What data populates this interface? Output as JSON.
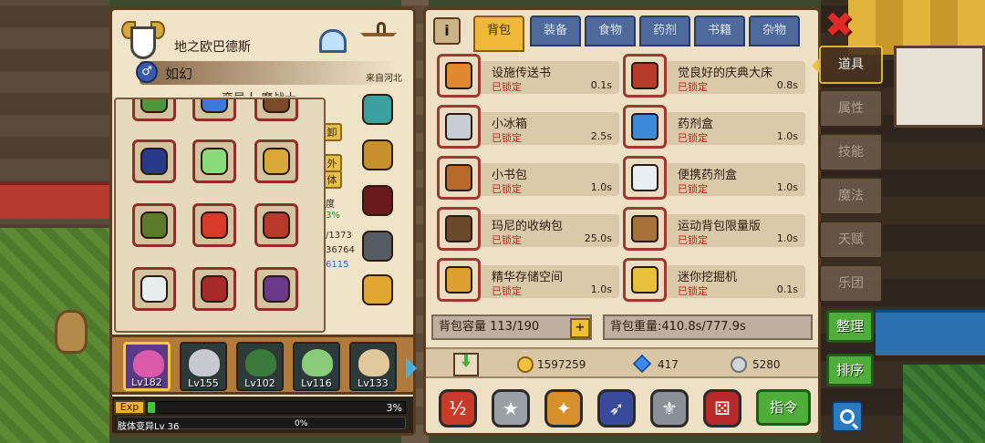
{
  "character": {
    "title": "地之欧巴德斯",
    "name": "如幻",
    "origin": "来自河北",
    "subtitle": "变异人 魔战士",
    "gender_icon": "male-symbol",
    "side_tags": [
      "卸",
      "外",
      "体"
    ],
    "stat_fragments": [
      "度",
      "3%",
      "/1373",
      "36764",
      "6115"
    ],
    "equipment_slots": [
      {
        "name": "green-bracelet",
        "color": "#4a9a3a"
      },
      {
        "name": "blue-amulet",
        "color": "#3a7ad8"
      },
      {
        "name": "dark-gauntlet",
        "color": "#7a4a2a"
      },
      {
        "name": "blue-gold-glove",
        "color": "#2a3a8a"
      },
      {
        "name": "green-mirror-ring",
        "color": "#8adc7a"
      },
      {
        "name": "gold-ring",
        "color": "#d8a83a"
      },
      {
        "name": "winged-boot",
        "color": "#5a7a2a"
      },
      {
        "name": "red-boot",
        "color": "#d83a2a"
      },
      {
        "name": "red-gauntlets",
        "color": "#b83a2a"
      },
      {
        "name": "white-sword-boot",
        "color": "#e8eef0"
      },
      {
        "name": "red-helmet",
        "color": "#a82a2a"
      },
      {
        "name": "purple-helmet",
        "color": "#6a3a8a"
      }
    ],
    "side_equipment": [
      {
        "name": "crystal-pendant",
        "color": "#3aa0a0"
      },
      {
        "name": "golden-armor",
        "color": "#c8902a"
      },
      {
        "name": "crimson-chest",
        "color": "#6a1a1a"
      },
      {
        "name": "iron-piece",
        "color": "#555c66"
      },
      {
        "name": "jeweled-ring",
        "color": "#e0a830"
      }
    ]
  },
  "party": [
    {
      "level": "Lv182",
      "color": "#d85aa8"
    },
    {
      "level": "Lv155",
      "color": "#c8c8d0"
    },
    {
      "level": "Lv102",
      "color": "#3a7a3a"
    },
    {
      "level": "Lv116",
      "color": "#8acc7a"
    },
    {
      "level": "Lv133",
      "color": "#e0c89a"
    }
  ],
  "experience": {
    "label": "Exp",
    "percent_text": "3%",
    "fill": 0.03,
    "sub_label": "肢体变异Lv 36",
    "sub_percent_text": "0%"
  },
  "inventory": {
    "tabs": [
      "背包",
      "装备",
      "食物",
      "药剂",
      "书籍",
      "杂物"
    ],
    "active_tab": 0,
    "items": [
      {
        "name": "设施传送书",
        "lock": "已锁定",
        "weight": "0.1s",
        "color": "#e08a30"
      },
      {
        "name": "觉良好的庆典大床",
        "lock": "已锁定",
        "weight": "0.8s",
        "color": "#b83a2a"
      },
      {
        "name": "小冰箱",
        "lock": "已锁定",
        "weight": "2.5s",
        "color": "#c8ccd4"
      },
      {
        "name": "药剂盒",
        "lock": "已锁定",
        "weight": "1.0s",
        "color": "#3a8ad8"
      },
      {
        "name": "小书包",
        "lock": "已锁定",
        "weight": "1.0s",
        "color": "#b86a2a"
      },
      {
        "name": "便携药剂盒",
        "lock": "已锁定",
        "weight": "1.0s",
        "color": "#e8eef4"
      },
      {
        "name": "玛尼的收纳包",
        "lock": "已锁定",
        "weight": "25.0s",
        "color": "#6a4a2a"
      },
      {
        "name": "运动背包限量版",
        "lock": "已锁定",
        "weight": "1.0s",
        "color": "#a8703a"
      },
      {
        "name": "精华存储空间",
        "lock": "已锁定",
        "weight": "1.0s",
        "color": "#e0a030"
      },
      {
        "name": "迷你挖掘机",
        "lock": "已锁定",
        "weight": "0.1s",
        "color": "#e8c03a"
      }
    ],
    "capacity": "背包容量 113/190",
    "weight": "背包重量:410.8s/777.9s",
    "currency": {
      "gold": "1597259",
      "diamond": "417",
      "silver": "5280"
    },
    "actions": [
      {
        "name": "sort-order",
        "color": "#c83a2a",
        "glyph": "½"
      },
      {
        "name": "star-filter",
        "color": "#9aa0a8",
        "glyph": "★"
      },
      {
        "name": "shuriken-filter",
        "color": "#d8902a",
        "glyph": "✦"
      },
      {
        "name": "runner-filter",
        "color": "#3a4a9a",
        "glyph": "➶"
      },
      {
        "name": "trident-filter",
        "color": "#8a9098",
        "glyph": "⚜"
      },
      {
        "name": "dice-filter",
        "color": "#b82a2a",
        "glyph": "⚄"
      }
    ],
    "command_label": "指令"
  },
  "side_menu": {
    "tabs": [
      "道具",
      "属性",
      "技能",
      "魔法",
      "天赋",
      "乐团"
    ],
    "active": 0,
    "organize_label": "整理",
    "sort_label": "排序"
  }
}
